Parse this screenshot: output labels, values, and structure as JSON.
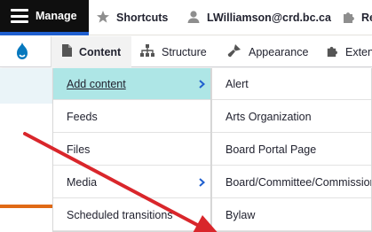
{
  "toolbar": {
    "manage": "Manage",
    "shortcuts": "Shortcuts",
    "user": "LWilliamson@crd.bc.ca",
    "more": "Re"
  },
  "tray": {
    "content": "Content",
    "structure": "Structure",
    "appearance": "Appearance",
    "extend": "Exten"
  },
  "content_menu": {
    "items": [
      "Add content",
      "Feeds",
      "Files",
      "Media",
      "Scheduled transitions"
    ]
  },
  "add_content_menu": {
    "items": [
      "Alert",
      "Arts Organization",
      "Board Portal Page",
      "Board/Committee/Commission",
      "Bylaw"
    ]
  },
  "colors": {
    "highlight": "#aee6e6",
    "accent": "#1f5fcf",
    "annotation_arrow": "#d9262b",
    "orange_rule": "#e06a16"
  },
  "icons": [
    "hamburger-icon",
    "star-icon",
    "user-icon",
    "puzzle-icon",
    "drupal-logo-icon",
    "file-icon",
    "structure-icon",
    "brush-icon",
    "chevron-right-icon"
  ]
}
